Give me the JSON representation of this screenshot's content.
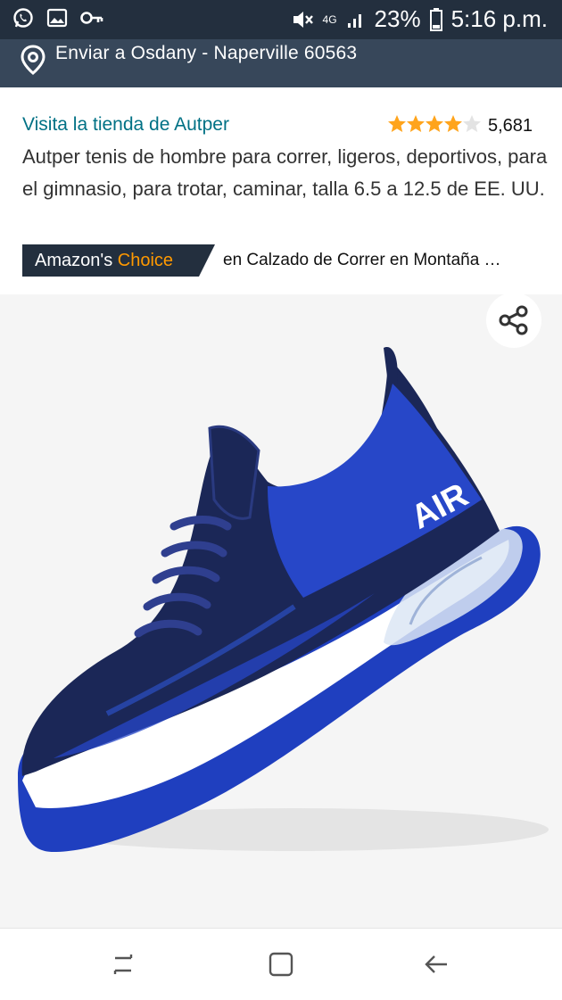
{
  "status_bar": {
    "battery": "23%",
    "time": "5:16 p.m.",
    "network": "4G",
    "icons": [
      "whatsapp-icon",
      "gallery-icon",
      "key-icon",
      "mute-icon",
      "signal-icon",
      "battery-icon"
    ]
  },
  "delivery": {
    "text": "Enviar a Osdany - Naperville 60563",
    "icon": "location-pin-icon"
  },
  "product": {
    "store_link": "Visita la tienda de Autper",
    "rating_value": 4,
    "rating_max": 5,
    "rating_count": "5,681",
    "title": "Autper tenis de hombre para correr, ligeros, deportivos, para el gimnasio, para trotar, caminar, talla 6.5 a 12.5 de EE. UU.",
    "badge_prefix": "Amazon's",
    "badge_choice": "Choice",
    "badge_category": "en Calzado de Correr en Montaña …",
    "image_text": "AIR",
    "share_icon": "share-icon"
  },
  "colors": {
    "header_dark": "#232f3e",
    "header_mid": "#37475a",
    "link": "#007185",
    "star": "#ffa41c",
    "choice_orange": "#ff9900",
    "shoe_blue": "#1f3fbf",
    "shoe_navy": "#1b2757"
  },
  "nav_bar": {
    "icons": [
      "recent-apps-icon",
      "home-icon",
      "back-icon"
    ]
  }
}
